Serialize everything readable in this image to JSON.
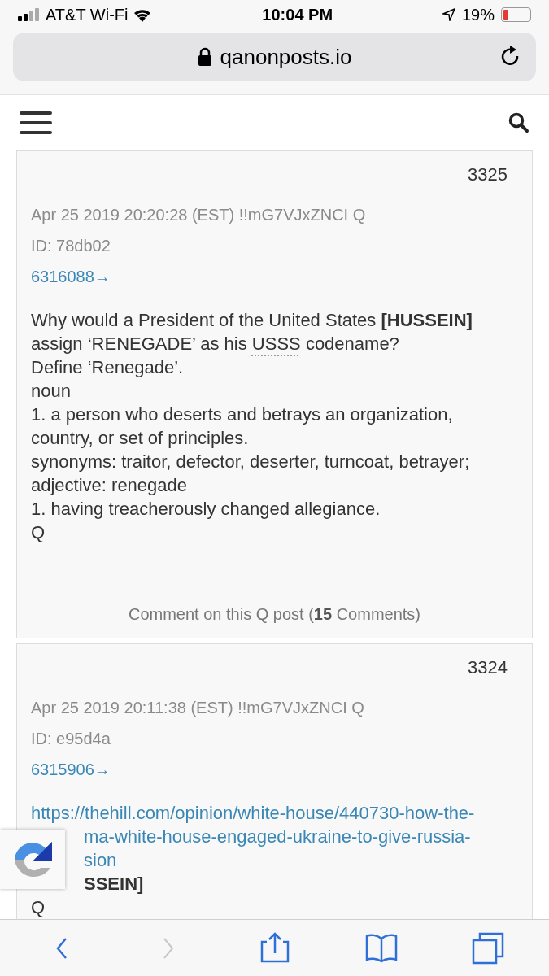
{
  "status_bar": {
    "carrier": "AT&T Wi-Fi",
    "time": "10:04 PM",
    "battery": "19%",
    "battery_level": {
      "level": 0.19
    }
  },
  "address_bar": {
    "url": "qanonposts.io"
  },
  "posts": [
    {
      "number": "3325",
      "meta": "Apr 25 2019 20:20:28 (EST) !!mG7VJxZNCI Q",
      "id": "ID: 78db02",
      "reply_link": "6316088→",
      "lines": [
        {
          "kind": "text",
          "covered": false,
          "segments": [
            {
              "kind": "plain",
              "text": "Why would a President of the United States "
            },
            {
              "kind": "bold",
              "text": "[HUSSEIN]"
            }
          ]
        },
        {
          "kind": "text",
          "covered": false,
          "segments": [
            {
              "kind": "plain",
              "text": "assign ‘RENEGADE’ as his "
            },
            {
              "kind": "abbr",
              "text": "USSS"
            },
            {
              "kind": "plain",
              "text": " codename?"
            }
          ]
        },
        {
          "kind": "text",
          "covered": false,
          "segments": [
            {
              "kind": "plain",
              "text": "Define ‘Renegade’."
            }
          ]
        },
        {
          "kind": "text",
          "covered": false,
          "segments": [
            {
              "kind": "plain",
              "text": "noun"
            }
          ]
        },
        {
          "kind": "text",
          "covered": false,
          "segments": [
            {
              "kind": "plain",
              "text": "1. a person who deserts and betrays an organization, country, or set of principles."
            }
          ]
        },
        {
          "kind": "text",
          "covered": false,
          "segments": [
            {
              "kind": "plain",
              "text": "synonyms: traitor, defector, deserter, turncoat, betrayer;"
            }
          ]
        },
        {
          "kind": "text",
          "covered": false,
          "segments": [
            {
              "kind": "plain",
              "text": "adjective: renegade"
            }
          ]
        },
        {
          "kind": "text",
          "covered": false,
          "segments": [
            {
              "kind": "plain",
              "text": "1. having treacherously changed allegiance."
            }
          ]
        },
        {
          "kind": "text",
          "covered": false,
          "segments": [
            {
              "kind": "plain",
              "text": "Q"
            }
          ]
        }
      ],
      "comments": {
        "before": "Comment on this Q post (",
        "count": "15",
        "after": " Comments)"
      }
    },
    {
      "number": "3324",
      "meta": "Apr 25 2019 20:11:38 (EST) !!mG7VJxZNCI Q",
      "id": "ID: e95d4a",
      "reply_link": "6315906→",
      "lines": [
        {
          "kind": "link",
          "covered": false,
          "segments": [
            {
              "kind": "plain",
              "text": "https://thehill.com/opinion/white-house/440730-how-the-"
            }
          ]
        },
        {
          "kind": "link",
          "covered": true,
          "segments": [
            {
              "kind": "plain",
              "text": "ma-white-house-engaged-ukraine-to-give-russia-"
            }
          ]
        },
        {
          "kind": "link",
          "covered": true,
          "segments": [
            {
              "kind": "plain",
              "text": "sion"
            }
          ]
        },
        {
          "kind": "text",
          "covered": true,
          "segments": [
            {
              "kind": "bold",
              "text": "SSEIN]"
            }
          ]
        },
        {
          "kind": "text",
          "covered": false,
          "segments": [
            {
              "kind": "plain",
              "text": "Q"
            }
          ]
        }
      ]
    }
  ],
  "toolbar": [
    {
      "kind": "back",
      "disabled": false
    },
    {
      "kind": "forward",
      "disabled": true
    },
    {
      "kind": "share",
      "disabled": false
    },
    {
      "kind": "bookmarks",
      "disabled": false
    },
    {
      "kind": "tabs",
      "disabled": false
    }
  ]
}
